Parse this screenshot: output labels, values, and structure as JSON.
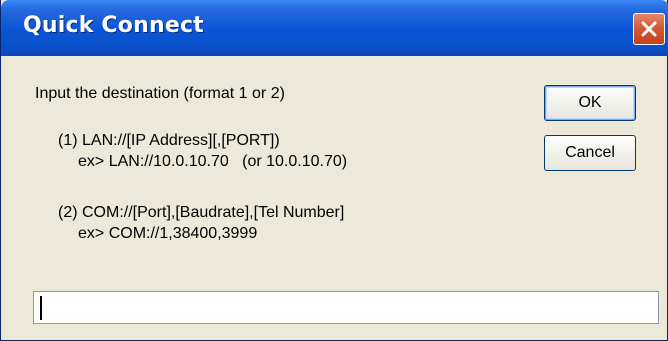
{
  "dialog": {
    "title": "Quick Connect",
    "close_label": "close"
  },
  "instructions": {
    "prompt": "Input the destination (format 1 or 2)",
    "format1_line1": "(1) LAN://[IP Address][,[PORT])",
    "format1_line2": "ex> LAN://10.0.10.70   (or 10.0.10.70)",
    "format2_line1": "(2) COM://[Port],[Baudrate],[Tel Number]",
    "format2_line2": "ex> COM://1,38400,3999"
  },
  "buttons": {
    "ok_label": "OK",
    "cancel_label": "Cancel"
  },
  "destination_input": {
    "value": ""
  },
  "colors": {
    "titlebar": "#0a55d6",
    "close_button": "#d65a36",
    "dialog_background": "#ece9d8"
  }
}
